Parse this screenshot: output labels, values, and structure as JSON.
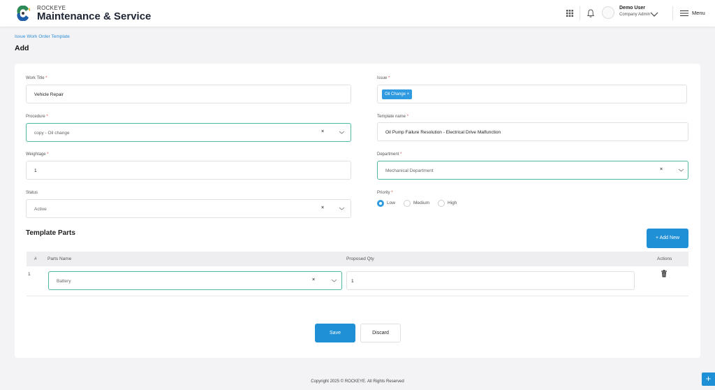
{
  "header": {
    "brand_small": "ROCKEYE",
    "brand_title": "Maintenance & Service",
    "user_name": "Demo User",
    "user_role": "Company Admin",
    "menu_label": "Menu",
    "icons": [
      "grid-icon",
      "bell-icon",
      "chevron-down-icon",
      "hamburger-icon"
    ]
  },
  "breadcrumb": "Issue Work Order Template",
  "page_title": "Add",
  "form": {
    "work_title": {
      "label": "Work Title",
      "value": "Vehicle Repair"
    },
    "issue": {
      "label": "Issue",
      "chip": "Oil Change ×"
    },
    "procedure": {
      "label": "Procedure",
      "value": "copy - Oil change"
    },
    "template_name": {
      "label": "Template name",
      "value": "Oil Pump Failure Resolution - Electrical Drive Malfunction"
    },
    "weightage": {
      "label": "Weightage",
      "value": "1"
    },
    "department": {
      "label": "Department",
      "value": "Mechanical Department"
    },
    "status": {
      "label": "Status",
      "value": "Active"
    },
    "priority": {
      "label": "Priority",
      "options": [
        "Low",
        "Medium",
        "High"
      ],
      "selected": "Low"
    },
    "required_marker": "*",
    "clear_symbol": "×"
  },
  "parts": {
    "title": "Template Parts",
    "add_button": "+ Add New",
    "columns": [
      "#",
      "Parts Name",
      "Proposed Qty",
      "Actions"
    ],
    "rows": [
      {
        "num": "1",
        "part": "Battery",
        "qty": "1"
      }
    ]
  },
  "actions": {
    "save": "Save",
    "discard": "Discard"
  },
  "footer": "Copyright 2025 © ROCKEYE. All Rights Reserved",
  "fab_symbol": "+",
  "colors": {
    "primary": "#1f90d6",
    "active_border": "#4fb8a2",
    "background": "#f3f3f5"
  }
}
